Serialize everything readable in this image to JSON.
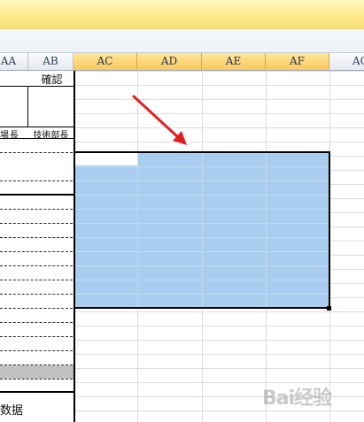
{
  "spreadsheet": {
    "columns": [
      "AA",
      "AB",
      "AC",
      "AD",
      "AE",
      "AF",
      "AG"
    ],
    "selected_columns": [
      "AC",
      "AD",
      "AE",
      "AF"
    ],
    "cells": {
      "ab_header": "確認",
      "aa_role": "場長",
      "ab_role": "技術部長",
      "bottom_label": "数据"
    }
  },
  "colors": {
    "selection": "#a9cdee",
    "selected_header": "#f9c95f",
    "arrow": "#e02020"
  },
  "watermark": {
    "text": "Bai经验"
  }
}
